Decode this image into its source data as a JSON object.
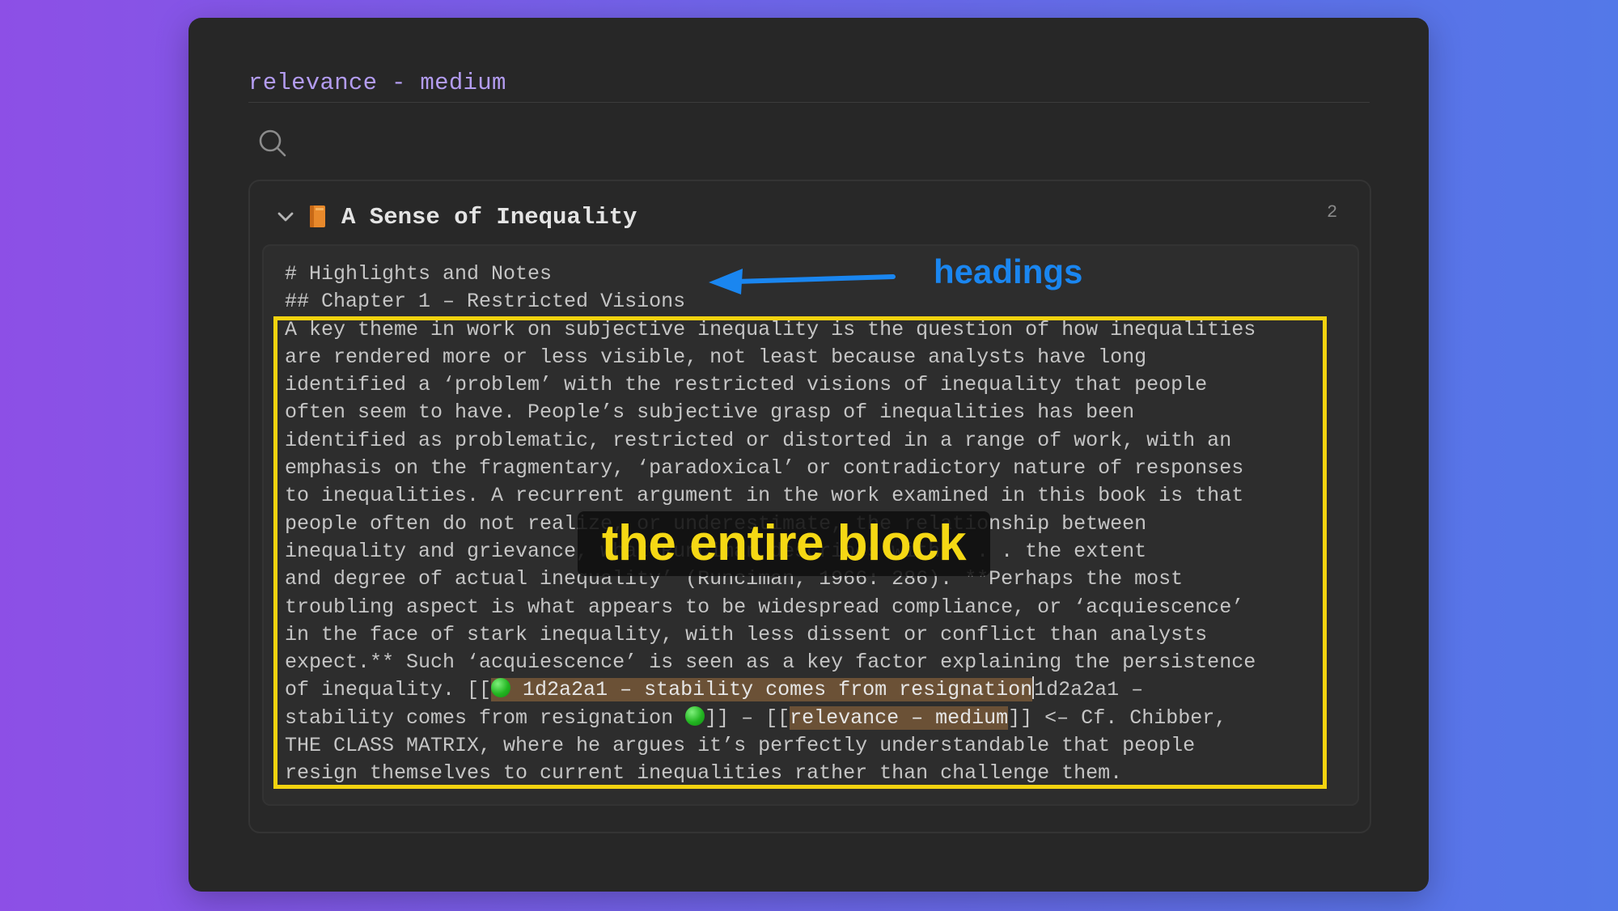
{
  "note": {
    "title": "relevance - medium"
  },
  "search": {
    "icon": "search-icon"
  },
  "result": {
    "title": "A Sense of Inequality",
    "match_count": "2",
    "icon": "book-icon",
    "lines": {
      "l1": "# Highlights and Notes",
      "l2": "## Chapter 1 – Restricted Visions",
      "l3": "A key theme in work on subjective inequality is the question of how inequalities",
      "l4": "are rendered more or less visible, not least because analysts have long",
      "l5": "identified a ‘problem’ with the restricted visions of inequality that people",
      "l6": "often seem to have. People’s subjective grasp of inequalities has been",
      "l7": "identified as problematic, restricted or distorted in a range of work, with an",
      "l8": "emphasis on the fragmentary, ‘paradoxical’ or contradictory nature of responses",
      "l9": "to inequalities. A recurrent argument in the work examined in this book is that",
      "l10": "people often do not realize, or underestimate, the relationship between",
      "l11": "inequality and grievance, what Runciman describes with . . . the extent",
      "l12": "and degree of actual inequality’ (Runciman, 1966: 286). **Perhaps the most",
      "l13": "troubling aspect is what appears to be widespread compliance, or ‘acquiescence’",
      "l14": "in the face of stark inequality, with less dissent or conflict than analysts",
      "l15": "expect.** Such ‘acquiescence’ is seen as a key factor explaining the persistence",
      "l16_pre": "of inequality. [[",
      "l16_hl": " 1d2a2a1 – stability comes from resignation",
      "l16_post": "1d2a2a1 –",
      "l17_pre": "stability comes from resignation ",
      "l17_mid": "]] – [[",
      "l17_hl": "relevance – medium",
      "l17_post": "]] <– Cf. Chibber,",
      "l18": "THE CLASS MATRIX, where he argues it’s perfectly understandable that people",
      "l19": "resign themselves to current inequalities rather than challenge them."
    }
  },
  "annotations": {
    "headings_label": "headings",
    "block_label": "the entire block",
    "arrow_color": "#1a86f0",
    "box_color": "#f3d30f"
  }
}
